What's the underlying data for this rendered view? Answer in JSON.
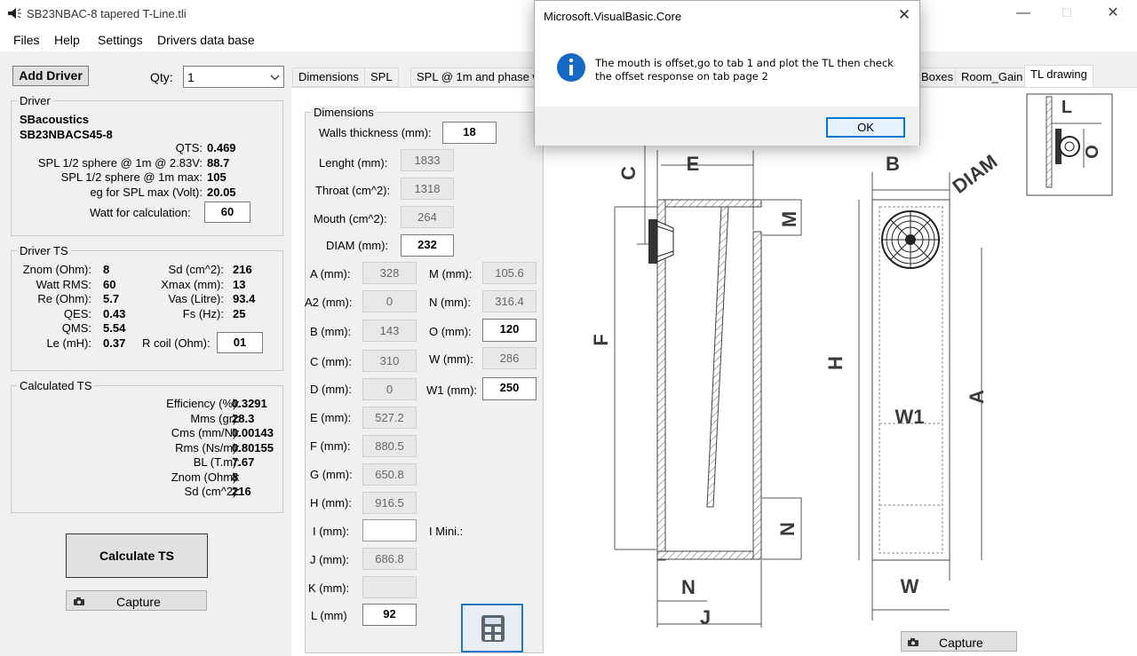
{
  "window": {
    "title": "SB23NBAC-8 tapered T-Line.tli"
  },
  "menu": [
    "Files",
    "Help",
    "Settings",
    "Drivers data base"
  ],
  "toolbar": {
    "add_driver": "Add Driver",
    "qty_label": "Qty:",
    "qty_value": "1"
  },
  "driver": {
    "group": "Driver",
    "brand": "SBacoustics",
    "model": "SB23NBACS45-8",
    "rows": [
      {
        "label": "QTS:",
        "value": "0.469"
      },
      {
        "label": "SPL 1/2 sphere @ 1m @ 2.83V:",
        "value": "88.7"
      },
      {
        "label": "SPL 1/2 sphere @ 1m max:",
        "value": "105"
      },
      {
        "label": "eg for SPL max (Volt):",
        "value": "20.05"
      }
    ],
    "watt_label": "Watt for calculation:",
    "watt_value": "60"
  },
  "ts": {
    "group": "Driver TS",
    "left": [
      {
        "label": "Znom (Ohm):",
        "value": "8"
      },
      {
        "label": "Watt RMS:",
        "value": "60"
      },
      {
        "label": "Re (Ohm):",
        "value": "5.7"
      },
      {
        "label": "QES:",
        "value": "0.43"
      },
      {
        "label": "QMS:",
        "value": "5.54"
      },
      {
        "label": "Le (mH):",
        "value": "0.37"
      }
    ],
    "right": [
      {
        "label": "Sd (cm^2):",
        "value": "216"
      },
      {
        "label": "Xmax (mm):",
        "value": "13"
      },
      {
        "label": "Vas (Litre):",
        "value": "93.4"
      },
      {
        "label": "Fs (Hz):",
        "value": "25"
      }
    ],
    "rcoil_label": "R coil (Ohm):",
    "rcoil_value": "01"
  },
  "calc": {
    "group": "Calculated TS",
    "rows": [
      {
        "label": "Efficiency (%):",
        "value": "0.3291"
      },
      {
        "label": "Mms (gr):",
        "value": "28.3"
      },
      {
        "label": "Cms (mm/N):",
        "value": "0.00143"
      },
      {
        "label": "Rms (Ns/m):",
        "value": "0.80155"
      },
      {
        "label": "BL (T.m):",
        "value": "7.67"
      },
      {
        "label": "Znom (Ohm):",
        "value": "8"
      },
      {
        "label": "Sd (cm^2):",
        "value": "216"
      }
    ],
    "calculate_button": "Calculate TS",
    "capture_button": "Capture"
  },
  "tabs": [
    "Dimensions",
    "SPL",
    "SPL @ 1m and phase w",
    "Boxes",
    "Room_Gain",
    "TL drawing"
  ],
  "dims": {
    "group": "Dimensions",
    "walls_label": "Walls thickness (mm):",
    "walls_value": "18",
    "lenght_label": "Lenght (mm):",
    "lenght_value": "1833",
    "throat_label": "Throat (cm^2):",
    "throat_value": "1318",
    "mouth_label": "Mouth (cm^2):",
    "mouth_value": "264",
    "diam_label": "DIAM (mm):",
    "diam_value": "232",
    "left": [
      {
        "label": "A (mm):",
        "value": "328"
      },
      {
        "label": "A2 (mm):",
        "value": "0"
      },
      {
        "label": "B (mm):",
        "value": "143"
      },
      {
        "label": "C (mm):",
        "value": "310"
      },
      {
        "label": "D (mm):",
        "value": "0"
      },
      {
        "label": "E (mm):",
        "value": "527.2"
      },
      {
        "label": "F (mm):",
        "value": "880.5"
      },
      {
        "label": "G (mm):",
        "value": "650.8"
      },
      {
        "label": "H (mm):",
        "value": "916.5"
      },
      {
        "label": "I (mm):",
        "value": ""
      },
      {
        "label": "J (mm):",
        "value": "686.8"
      },
      {
        "label": "K (mm):",
        "value": ""
      },
      {
        "label": "L (mm)",
        "value": "92"
      }
    ],
    "right": [
      {
        "label": "M (mm):",
        "value": "105.6"
      },
      {
        "label": "N (mm):",
        "value": "316.4"
      },
      {
        "label": "O (mm):",
        "value": "120"
      },
      {
        "label": "W (mm):",
        "value": "286"
      },
      {
        "label": "W1 (mm):",
        "value": "250"
      }
    ],
    "imini_label": "I Mini.:"
  },
  "drawing": {
    "labels": {
      "C": "C",
      "E": "E",
      "B": "B",
      "DIAM": "DIAM",
      "M": "M",
      "F": "F",
      "H": "H",
      "A": "A",
      "W1": "W1",
      "N1": "N",
      "N2": "N",
      "J": "J",
      "W": "W",
      "L": "L",
      "O": "O"
    },
    "capture_button": "Capture"
  },
  "dialog": {
    "title": "Microsoft.VisualBasic.Core",
    "message_line1": "The mouth is offset,go to tab 1 and plot the TL then check",
    "message_line2": "the offset response on tab page 2",
    "ok": "OK"
  }
}
